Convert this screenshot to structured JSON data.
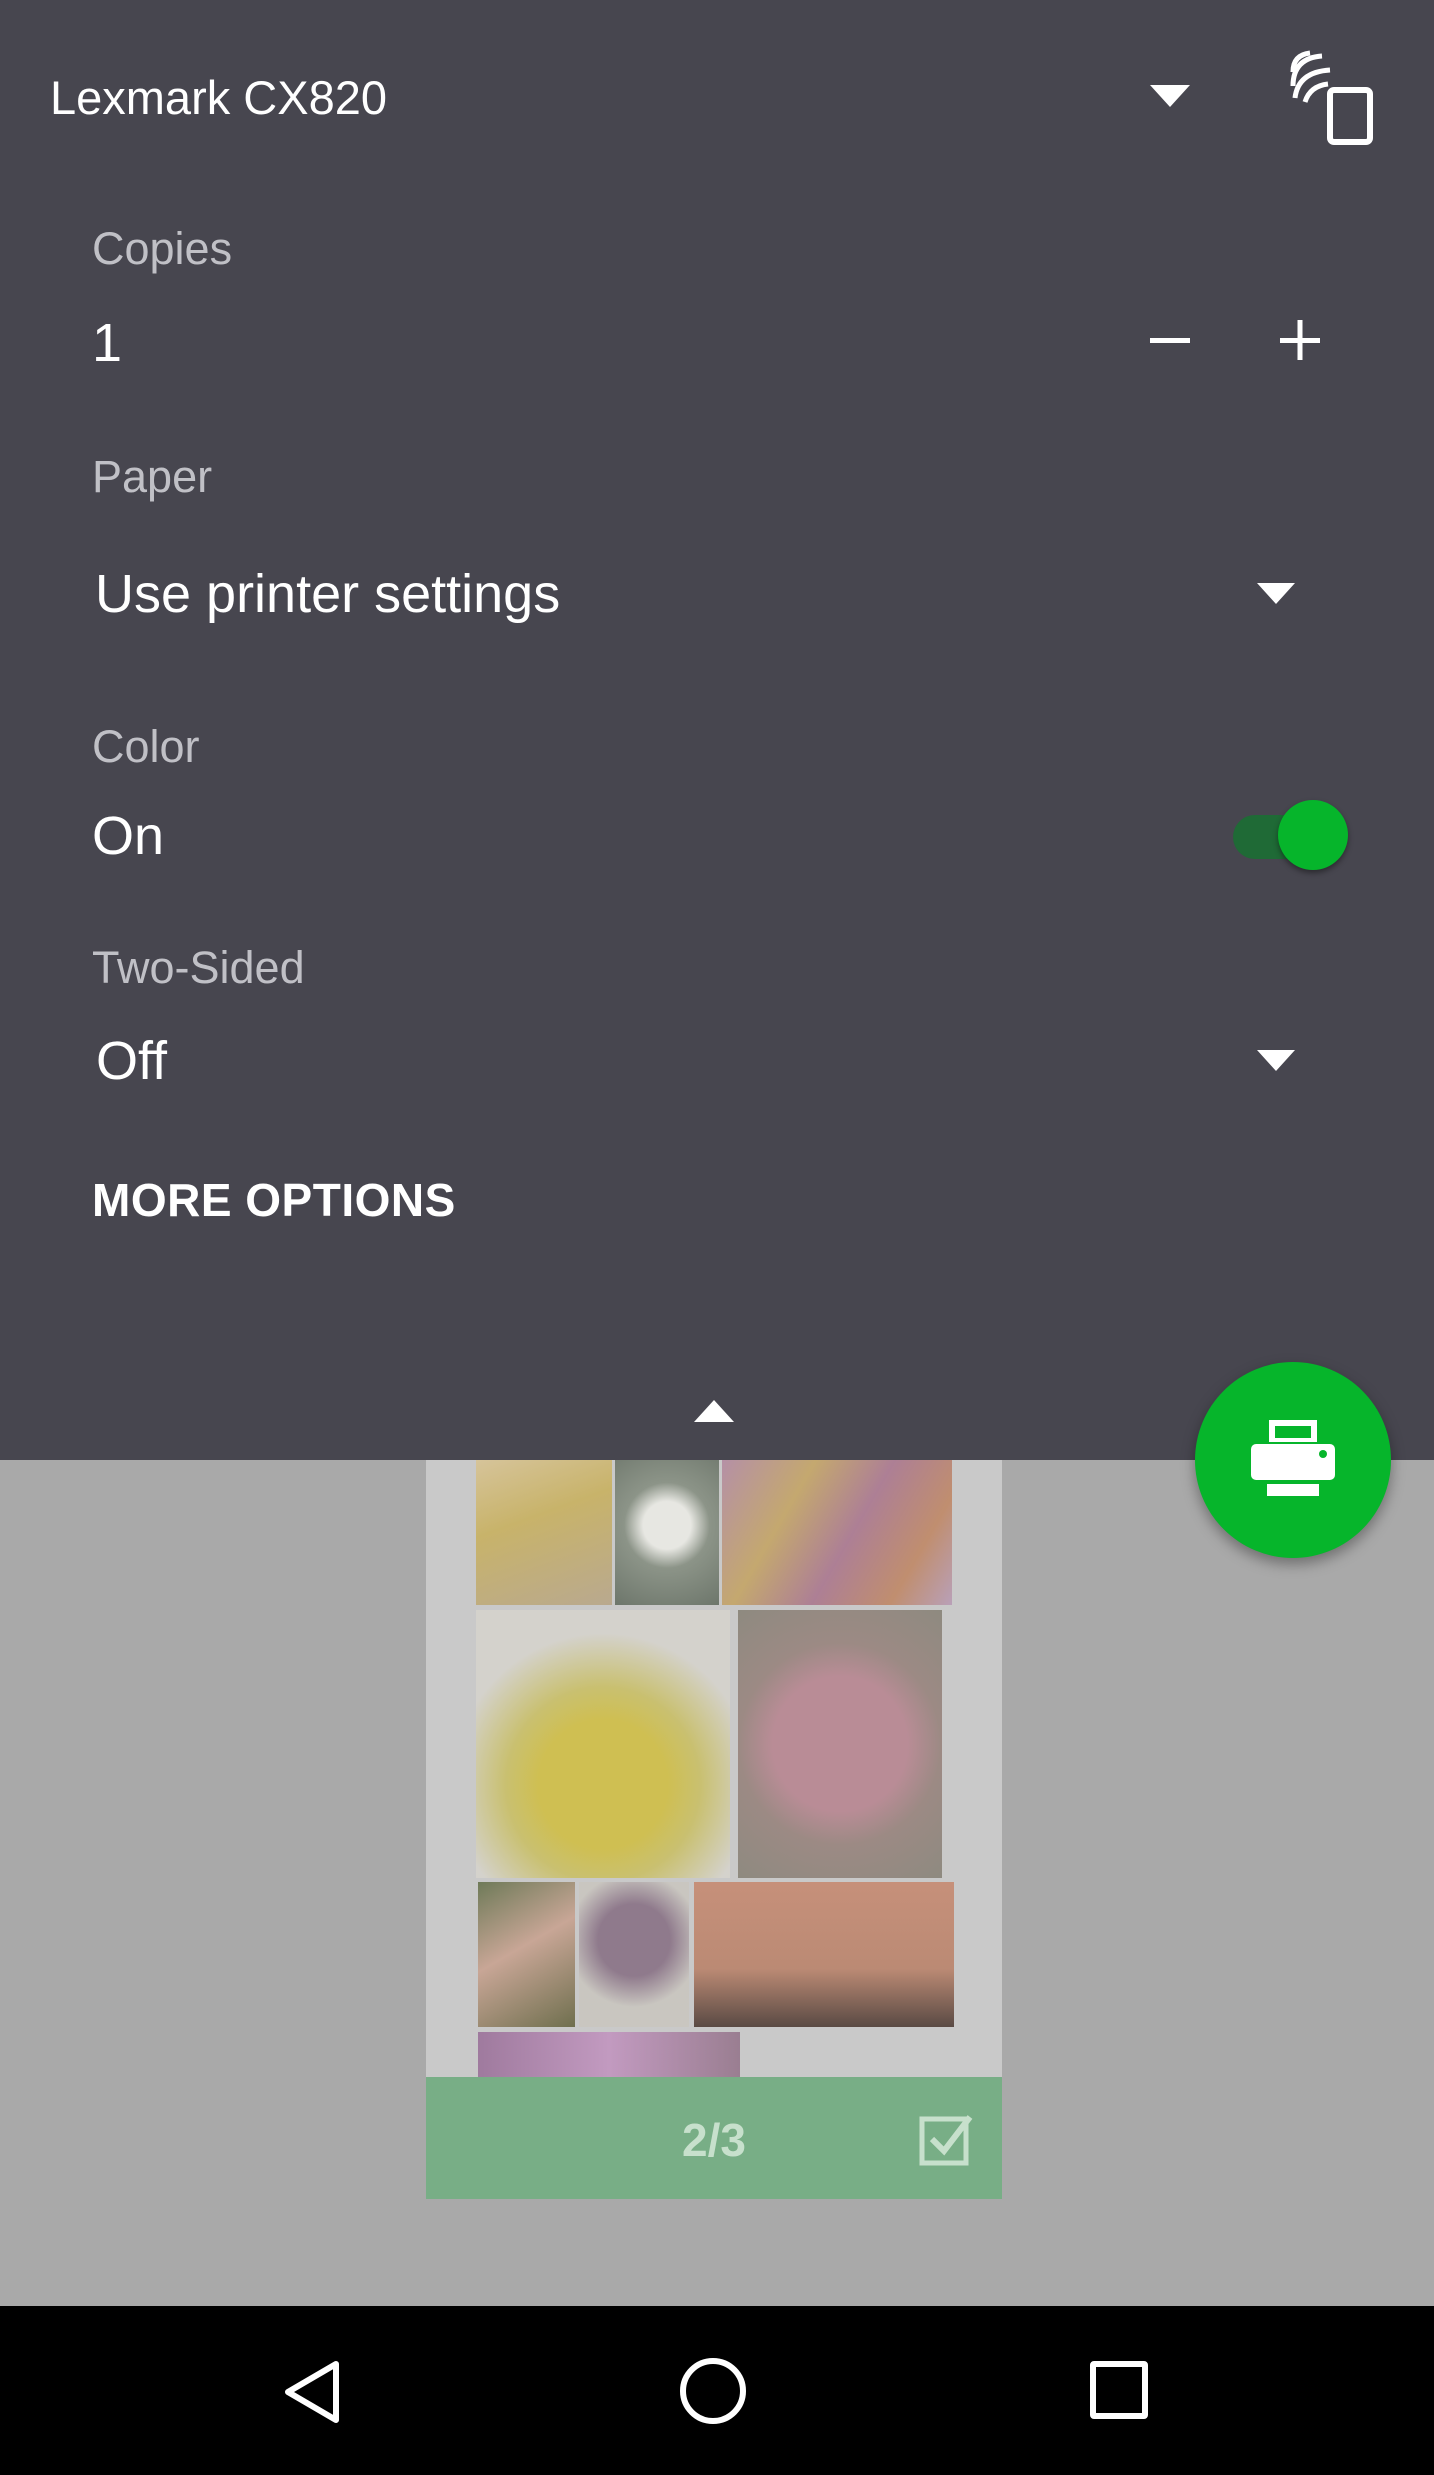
{
  "printer": {
    "name": "Lexmark CX820",
    "dropdown_icon": "dropdown-arrow-icon",
    "service_icon": "print-service-icon"
  },
  "copies": {
    "label": "Copies",
    "value": "1",
    "minus_icon": "minus-icon",
    "plus_icon": "plus-icon"
  },
  "paper": {
    "label": "Paper",
    "value": "Use printer settings"
  },
  "color": {
    "label": "Color",
    "value": "On",
    "toggle_on": true
  },
  "two_sided": {
    "label": "Two-Sided",
    "value": "Off"
  },
  "more_options": "MORE OPTIONS",
  "preview": {
    "page_number": "2/3",
    "selected": true
  },
  "colors": {
    "panel": "#47464f",
    "accent": "#06b52b",
    "preview_bg": "#a9a9a9",
    "page_footer": "#78ae86"
  }
}
